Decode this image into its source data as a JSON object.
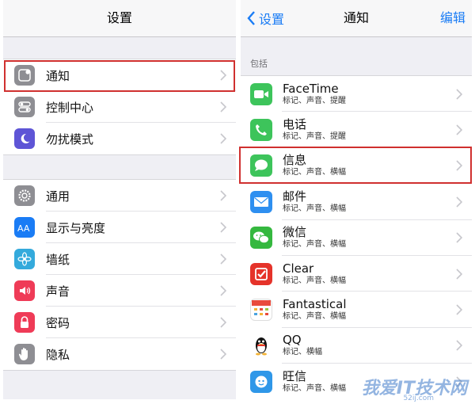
{
  "left": {
    "title": "设置",
    "group1": [
      {
        "label": "通知",
        "icon": "notifications-icon",
        "color": "#8e8e93"
      },
      {
        "label": "控制中心",
        "icon": "control-center-icon",
        "color": "#8e8e93"
      },
      {
        "label": "勿扰模式",
        "icon": "moon-icon",
        "color": "#5e55d6"
      }
    ],
    "group2": [
      {
        "label": "通用",
        "icon": "gear-icon",
        "color": "#8e8e93"
      },
      {
        "label": "显示与亮度",
        "icon": "display-icon",
        "color": "#1a7cf5"
      },
      {
        "label": "墙纸",
        "icon": "wallpaper-flower-icon",
        "color": "#34aadc"
      },
      {
        "label": "声音",
        "icon": "speaker-icon",
        "color": "#ef3b57"
      },
      {
        "label": "密码",
        "icon": "lock-icon",
        "color": "#ef3b57"
      },
      {
        "label": "隐私",
        "icon": "hand-icon",
        "color": "#8e8e93"
      }
    ]
  },
  "right": {
    "back_label": "设置",
    "title": "通知",
    "edit_label": "编辑",
    "section_label": "包括",
    "apps": [
      {
        "name": "FaceTime",
        "detail": "标记、声音、提醒",
        "icon": "facetime-icon",
        "color": "#3dc45b"
      },
      {
        "name": "电话",
        "detail": "标记、声音、提醒",
        "icon": "phone-icon",
        "color": "#3dc45b"
      },
      {
        "name": "信息",
        "detail": "标记、声音、横幅",
        "icon": "messages-icon",
        "color": "#3dc45b"
      },
      {
        "name": "邮件",
        "detail": "标记、声音、横幅",
        "icon": "mail-icon",
        "color": "#2e8ff0"
      },
      {
        "name": "微信",
        "detail": "标记、声音、横幅",
        "icon": "wechat-icon",
        "color": "#35b83f"
      },
      {
        "name": "Clear",
        "detail": "标记、声音、横幅",
        "icon": "clear-check-icon",
        "color": "#e5332a"
      },
      {
        "name": "Fantastical",
        "detail": "标记、声音、横幅",
        "icon": "calendar-icon",
        "color": "#e94b3c"
      },
      {
        "name": "QQ",
        "detail": "标记、横幅",
        "icon": "qq-penguin-icon",
        "color": "#ffffff"
      },
      {
        "name": "旺信",
        "detail": "标记、声音、横幅",
        "icon": "wangxin-icon",
        "color": "#2f97e8"
      }
    ]
  },
  "watermark": {
    "text": "我爱IT技术网",
    "url": "52ij.com"
  },
  "colors": {
    "accent": "#1a7cf5",
    "highlight": "#d0302f",
    "background": "#efeff4"
  }
}
